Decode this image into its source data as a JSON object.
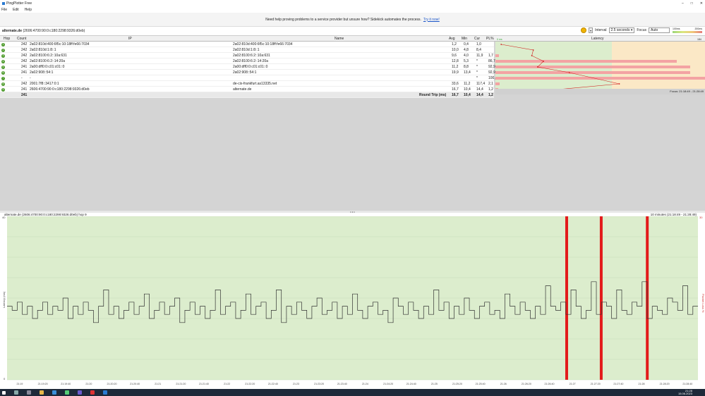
{
  "window": {
    "title": "PingPlotter Free",
    "controls": [
      "–",
      "□",
      "✕"
    ]
  },
  "menu": [
    "File",
    "Edit",
    "Help"
  ],
  "banner": {
    "text": "Need help proving problems to a service provider but unsure how? Sidekick automates the process.",
    "link": "Try it now!"
  },
  "target": {
    "host": "alternate.de",
    "address": "(2606:4700:90:0:c180:2298:9326:d0eb)"
  },
  "controls": {
    "interval_label": "Interval",
    "interval_value": "2.5 seconds",
    "focus_label": "Focus",
    "focus_value": "Auto"
  },
  "scale_legend": [
    "100ms",
    "200ms"
  ],
  "grid": {
    "headers": {
      "hop": "Hop",
      "count": "Count",
      "ip": "IP",
      "name": "Name",
      "avg": "Avg",
      "min": "Min",
      "cur": "Cur",
      "pl": "PL%",
      "latency": "Latency",
      "latency_left": "0 ms",
      "latency_right": "184 ms"
    },
    "rows": [
      {
        "hop": "1",
        "count": "242",
        "ip": "2a02:810d:400:6f5c:10:18ff:fe66:7034",
        "name": "2a02:810d:400:6f5c:10:18ff:fe66:7034",
        "avg": "1,2",
        "min": "0,4",
        "cur": "1,0",
        "pl": ""
      },
      {
        "hop": "2",
        "count": "242",
        "ip": "2a02:810d:1:8::1",
        "name": "2a02:810d:1:8::1",
        "avg": "10,0",
        "min": "4,8",
        "cur": "8,4",
        "pl": ""
      },
      {
        "hop": "3",
        "count": "242",
        "ip": "2a02:8100:6:2::10a:631",
        "name": "2a02:8100:6:2::10a:631",
        "avg": "9,6",
        "min": "4,0",
        "cur": "11,9",
        "pl": "1,7"
      },
      {
        "hop": "4",
        "count": "242",
        "ip": "2a02:8100:6:2::14:20a",
        "name": "2a02:8100:6:2::14:20a",
        "avg": "12,8",
        "min": "5,3",
        "cur": "*",
        "pl": "86,7"
      },
      {
        "hop": "5",
        "count": "241",
        "ip": "2a00:dff0:0:c01:c01::0",
        "name": "2a00:dff0:0:c01:c01::0",
        "avg": "11,2",
        "min": "8,8",
        "cur": "*",
        "pl": "92,9"
      },
      {
        "hop": "6",
        "count": "241",
        "ip": "2a02:908::54:1",
        "name": "2a02:908::54:1",
        "avg": "19,9",
        "min": "13,4",
        "cur": "*",
        "pl": "92,9"
      },
      {
        "hop": "7",
        "count": "-",
        "ip": "-",
        "name": "",
        "avg": "",
        "min": "",
        "cur": "*",
        "pl": "100,0"
      },
      {
        "hop": "8",
        "count": "242",
        "ip": "2001:7f8::3417:0:1",
        "name": "de-cix-frankfurt.as13335.net",
        "avg": "33,6",
        "min": "11,2",
        "cur": "117,4",
        "pl": "2,1"
      },
      {
        "hop": "9",
        "count": "241",
        "ip": "2606:4700:90:0:c180:2298:9326:d0eb",
        "name": "alternate.de",
        "avg": "16,7",
        "min": "10,4",
        "cur": "14,4",
        "pl": "1,2"
      }
    ],
    "total": {
      "count": "241",
      "label": "Round Trip (ms)",
      "avg": "16,7",
      "min": "10,4",
      "cur": "14,4",
      "pl": "1,2"
    },
    "focus_text": "Focus: 21:18:49 - 21:28:49"
  },
  "timeline": {
    "title": "alternate.de (2606:4700:90:0:c180:2298:9326:d0eb) hop 9",
    "range": "10 minutes (21:18:49 - 21:28:49)",
    "y_axis_label": "Latency (ms)",
    "y_right_label": "Packet Loss %",
    "y_top": "40",
    "y_bottom": "0",
    "y_right_top": "30",
    "x_ticks": [
      "21:19",
      "21:19:20",
      "21:19:40",
      "21:20",
      "21:20:20",
      "21:20:40",
      "21:21",
      "21:21:20",
      "21:21:40",
      "21:22",
      "21:22:20",
      "21:22:40",
      "21:23",
      "21:23:20",
      "21:23:40",
      "21:24",
      "21:24:20",
      "21:24:40",
      "21:25",
      "21:25:20",
      "21:25:40",
      "21:26",
      "21:26:20",
      "21:26:40",
      "21:27",
      "21:27:20",
      "21:27:40",
      "21:28",
      "21:28:20",
      "21:28:40"
    ]
  },
  "chart_data": {
    "type": "line",
    "title": "alternate.de (2606:4700:90:0:c180:2298:9326:d0eb) hop 9",
    "xlabel": "",
    "ylabel": "Latency (ms)",
    "ylim": [
      0,
      40
    ],
    "series": [
      {
        "values": [
          18,
          17,
          19,
          16,
          18,
          15,
          17,
          19,
          16,
          18,
          17,
          20,
          15,
          18,
          16,
          19,
          17,
          14,
          18,
          22,
          16,
          18,
          15,
          17,
          19,
          16,
          18,
          21,
          15,
          17,
          19,
          16,
          18,
          20,
          14,
          17,
          19,
          16,
          18,
          15,
          17,
          22,
          16,
          18,
          19,
          15,
          17,
          21,
          16,
          18,
          19,
          15,
          17,
          22,
          14,
          18,
          16,
          19,
          17,
          15,
          18,
          20,
          16,
          17,
          19,
          15,
          18,
          16,
          21,
          17,
          15,
          18,
          19,
          16,
          17,
          14,
          20,
          18,
          16,
          19,
          17,
          15,
          18,
          16,
          22,
          17,
          19,
          15,
          18,
          16,
          20,
          17,
          15,
          18,
          19,
          16,
          17,
          15,
          21,
          18,
          16,
          19,
          17,
          15,
          18,
          16,
          23,
          18,
          17,
          19,
          16,
          22,
          18,
          15,
          17,
          24,
          16,
          19,
          18,
          15,
          22,
          17,
          16,
          19,
          18,
          24,
          15,
          18,
          17,
          16,
          20,
          19,
          17,
          23,
          16,
          18
        ]
      }
    ],
    "loss_markers_time": [
      "21:26:55",
      "21:27:25",
      "21:28:05"
    ],
    "grid": true
  },
  "taskbar": {
    "time": "21:28",
    "date": "15.06.2023"
  },
  "colors": {
    "good": "#dcedcd",
    "warn": "#fbe8c6",
    "loss": "#e31b1b",
    "line": "#333333"
  }
}
